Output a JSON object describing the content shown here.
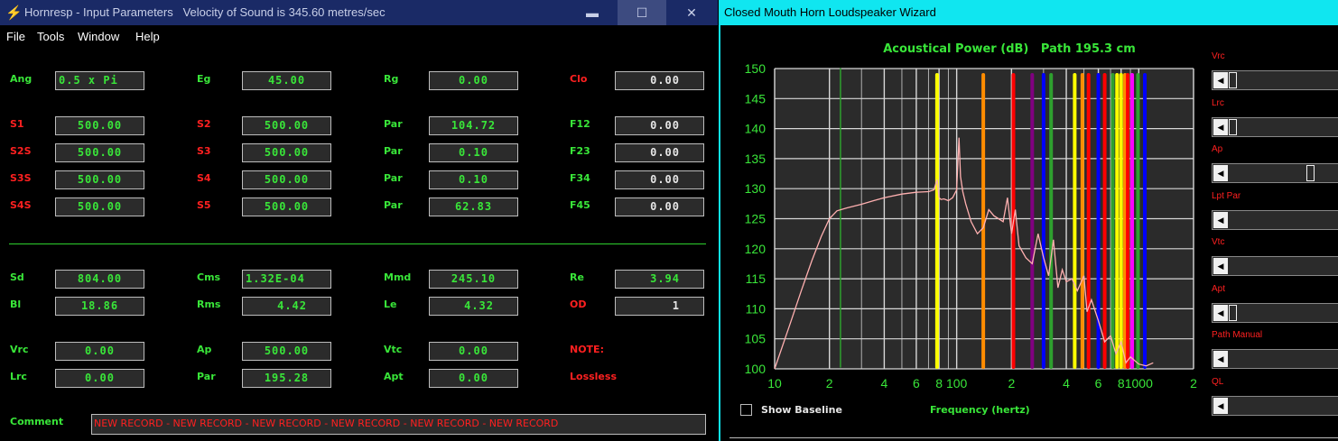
{
  "left_window": {
    "title": "Hornresp - Input Parameters",
    "velocity": "Velocity of Sound is 345.60 metres/sec",
    "window_buttons": {
      "minimize": "▬",
      "maximize": "☐",
      "close": "✕"
    },
    "menu": [
      "File",
      "Tools",
      "Window",
      "Help"
    ],
    "params": [
      {
        "label": "Ang",
        "value": "0.5 x Pi"
      },
      {
        "label": "Eg",
        "value": "45.00"
      },
      {
        "label": "Rg",
        "value": "0.00"
      },
      {
        "label": "Clo",
        "value": "0.00"
      },
      {
        "label": "S1",
        "value": "500.00"
      },
      {
        "label": "S2",
        "value": "500.00"
      },
      {
        "label": "Par",
        "value": "104.72"
      },
      {
        "label": "F12",
        "value": "0.00"
      },
      {
        "label": "S2S",
        "value": "500.00"
      },
      {
        "label": "S3",
        "value": "500.00"
      },
      {
        "label": "Par",
        "value": "0.10"
      },
      {
        "label": "F23",
        "value": "0.00"
      },
      {
        "label": "S3S",
        "value": "500.00"
      },
      {
        "label": "S4",
        "value": "500.00"
      },
      {
        "label": "Par",
        "value": "0.10"
      },
      {
        "label": "F34",
        "value": "0.00"
      },
      {
        "label": "S4S",
        "value": "500.00"
      },
      {
        "label": "S5",
        "value": "500.00"
      },
      {
        "label": "Par",
        "value": "62.83"
      },
      {
        "label": "F45",
        "value": "0.00"
      },
      {
        "label": "Sd",
        "value": "804.00"
      },
      {
        "label": "Cms",
        "value": "1.32E-04"
      },
      {
        "label": "Mmd",
        "value": "245.10"
      },
      {
        "label": "Re",
        "value": "3.94"
      },
      {
        "label": "Bl",
        "value": "18.86"
      },
      {
        "label": "Rms",
        "value": "4.42"
      },
      {
        "label": "Le",
        "value": "4.32"
      },
      {
        "label": "OD",
        "value": "1"
      },
      {
        "label": "Vrc",
        "value": "0.00"
      },
      {
        "label": "Ap",
        "value": "500.00"
      },
      {
        "label": "Vtc",
        "value": "0.00"
      },
      {
        "label": "NOTE:",
        "value": ""
      },
      {
        "label": "Lrc",
        "value": "0.00"
      },
      {
        "label": "Par",
        "value": "195.28"
      },
      {
        "label": "Apt",
        "value": "0.00"
      },
      {
        "label": "Lossless",
        "value": ""
      }
    ],
    "comment_label": "Comment",
    "comment_value": "NEW RECORD - NEW RECORD - NEW RECORD - NEW RECORD - NEW RECORD - NEW RECORD"
  },
  "right_window": {
    "title": "Closed Mouth Horn Loudspeaker Wizard",
    "show_baseline_label": "Show Baseline",
    "sliders": [
      {
        "label": "Vrc",
        "level": 0.0
      },
      {
        "label": "Lrc",
        "level": 0.0
      },
      {
        "label": "Ap",
        "level": 0.78
      },
      {
        "label": "Lpt Par",
        "level": null
      },
      {
        "label": "Vtc",
        "level": null
      },
      {
        "label": "Apt",
        "level": 0.0
      },
      {
        "label": "Path Manual",
        "level": null
      },
      {
        "label": "QL",
        "level": null
      }
    ],
    "chart_data": {
      "type": "line",
      "title": "Acoustical Power (dB)   Path 195.3 cm",
      "xlabel": "Frequency (hertz)",
      "ylabel": "",
      "x_scale": "log",
      "xlim": [
        10,
        2000
      ],
      "ylim": [
        100,
        150
      ],
      "y_ticks": [
        100,
        105,
        110,
        115,
        120,
        125,
        130,
        135,
        140,
        145,
        150
      ],
      "x_tick_labels": [
        {
          "value": 10,
          "text": "10"
        },
        {
          "value": 20,
          "text": "2"
        },
        {
          "value": 40,
          "text": "4"
        },
        {
          "value": 60,
          "text": "6"
        },
        {
          "value": 80,
          "text": "8"
        },
        {
          "value": 100,
          "text": "100"
        },
        {
          "value": 200,
          "text": "2"
        },
        {
          "value": 400,
          "text": "4"
        },
        {
          "value": 600,
          "text": "6"
        },
        {
          "value": 800,
          "text": "8"
        },
        {
          "value": 1000,
          "text": "1000"
        },
        {
          "value": 2000,
          "text": "2"
        }
      ],
      "grid": true,
      "series": [
        {
          "color": "#ffb0b0",
          "x": [
            10,
            12,
            14,
            16,
            18,
            20,
            22,
            25,
            30,
            35,
            40,
            50,
            60,
            70,
            75,
            78,
            80,
            82,
            85,
            90,
            95,
            100,
            103,
            105,
            108,
            112,
            120,
            130,
            140,
            150,
            160,
            180,
            190,
            200,
            210,
            220,
            240,
            260,
            280,
            300,
            320,
            340,
            360,
            380,
            400,
            430,
            460,
            500,
            520,
            550,
            600,
            650,
            700,
            750,
            800,
            850,
            900,
            1000,
            1100,
            1200
          ],
          "y": [
            100,
            107,
            113,
            118,
            122,
            125,
            126.3,
            126.8,
            127.4,
            128,
            128.5,
            129.1,
            129.4,
            129.5,
            129.8,
            131.5,
            128.5,
            128.2,
            128.3,
            128,
            128.5,
            129.8,
            138.5,
            132,
            129.5,
            127.5,
            124.5,
            122.5,
            123.5,
            126.5,
            125.5,
            124.5,
            128.5,
            122.5,
            126.5,
            120.5,
            118.5,
            117.5,
            122.5,
            118.5,
            115.5,
            121.5,
            113.5,
            116.5,
            114.5,
            115,
            113,
            115.5,
            109.5,
            111.5,
            108,
            104.5,
            105.5,
            102.5,
            104.5,
            101,
            102,
            100.8,
            100.5,
            101
          ]
        }
      ],
      "markers": [
        {
          "x": 23,
          "color": "#2ea02e"
        },
        {
          "x": 78,
          "color": "#ffff00"
        },
        {
          "x": 140,
          "color": "#ff8c00"
        },
        {
          "x": 205,
          "color": "#ff0000"
        },
        {
          "x": 260,
          "color": "#800080"
        },
        {
          "x": 300,
          "color": "#0000ff"
        },
        {
          "x": 330,
          "color": "#2ea02e"
        },
        {
          "x": 445,
          "color": "#ffff00"
        },
        {
          "x": 490,
          "color": "#ff8c00"
        },
        {
          "x": 530,
          "color": "#ff0000"
        },
        {
          "x": 600,
          "color": "#0000ff"
        },
        {
          "x": 650,
          "color": "#ff0000"
        },
        {
          "x": 720,
          "color": "#2ea02e"
        },
        {
          "x": 760,
          "color": "#ffff00"
        },
        {
          "x": 800,
          "color": "#ffff00"
        },
        {
          "x": 840,
          "color": "#ff8c00"
        },
        {
          "x": 870,
          "color": "#ff0000"
        },
        {
          "x": 920,
          "color": "#ff00ff"
        },
        {
          "x": 990,
          "color": "#2ea02e"
        },
        {
          "x": 1080,
          "color": "#0000ff"
        }
      ]
    }
  }
}
